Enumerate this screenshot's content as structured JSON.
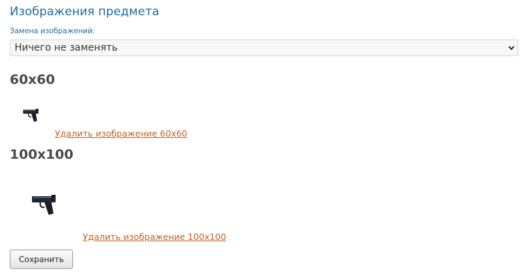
{
  "page": {
    "title": "Изображения предмета"
  },
  "replace": {
    "label": "Замена изображений:",
    "selected": "Ничего не заменять",
    "chevron_icon": "chevron-down-icon"
  },
  "images": [
    {
      "size_label": "60x60",
      "delete_link": "Удалить изображение 60x60",
      "icon": "pistol-icon"
    },
    {
      "size_label": "100x100",
      "delete_link": "Удалить изображение 100x100",
      "icon": "pistol-icon"
    }
  ],
  "actions": {
    "save_label": "Сохранить"
  }
}
